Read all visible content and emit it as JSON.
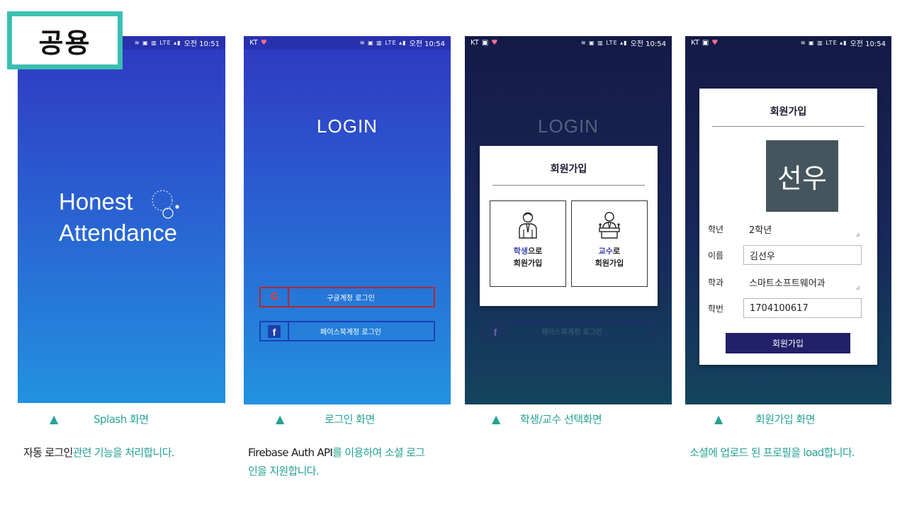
{
  "tag": {
    "label": "공용"
  },
  "screens": {
    "splash": {
      "status": {
        "carrier": "",
        "icons": "≋ ▣ ▥ LTE ▴▮",
        "time": "오전 10:51"
      },
      "title_line1": "Honest",
      "title_line2": "Attendance",
      "logo_icon": "circle-dots-logo-icon"
    },
    "login": {
      "status": {
        "carrier": "KT",
        "icons": "≋ ▣ ▥ LTE ▴▮",
        "time": "오전 10:54"
      },
      "title": "LOGIN",
      "google_button": {
        "icon": "G",
        "label": "구글계정 로그인"
      },
      "facebook_button": {
        "icon": "f",
        "label": "페이스북계정 로그인"
      }
    },
    "select": {
      "status": {
        "carrier": "KT",
        "icons": "≋ ▣ ▥ LTE ▴▮",
        "time": "오전 10:54"
      },
      "title": "LOGIN",
      "facebook_button": {
        "icon": "f",
        "label": "페이스북계정 로그인"
      },
      "dialog": {
        "title": "회원가입",
        "student": {
          "highlight": "학생",
          "rest": "으로",
          "line2": "회원가입"
        },
        "professor": {
          "highlight": "교수",
          "rest": "로",
          "line2": "회원가입"
        }
      }
    },
    "signup": {
      "status": {
        "carrier": "KT",
        "icons": "≋ ▣ ▥ LTE ▴▮",
        "time": "오전 10:54"
      },
      "dialog": {
        "title": "회원가입",
        "avatar_text": "선우",
        "fields": {
          "grade": {
            "label": "학년",
            "value": "2학년"
          },
          "name": {
            "label": "이름",
            "value": "김선우"
          },
          "dept": {
            "label": "학과",
            "value": "스마트소프트웨어과"
          },
          "student_id": {
            "label": "학번",
            "value": "1704100617"
          }
        },
        "submit_label": "회원가입"
      }
    }
  },
  "captions": {
    "c1": {
      "marker": "▲",
      "text": "Splash 화면"
    },
    "c2": {
      "marker": "▲",
      "text": "로그인 화면"
    },
    "c3": {
      "marker": "▲",
      "text": "학생/교수 선택화면"
    },
    "c4": {
      "marker": "▲",
      "text": "회원가입 화면"
    }
  },
  "descriptions": {
    "d1": {
      "dark": "자동 로그인",
      "teal": "관련 기능을 처리합니다."
    },
    "d2": {
      "dark": "Firebase Auth API",
      "teal": "를 이용하여 소셜 로그",
      "line2": "인을 지원합니다."
    },
    "d4": {
      "teal": "소셜에 업로드 된 프로필을 load합니다."
    }
  },
  "colors": {
    "accent_teal": "#26a196",
    "tag_border": "#3bbfb2",
    "blue_gradient_top": "#3037c2",
    "blue_gradient_bottom": "#2292e0",
    "dark_gradient_top": "#141a46",
    "submit_button": "#222069",
    "google_border": "#b3282e",
    "facebook_border": "#1a40b8"
  }
}
